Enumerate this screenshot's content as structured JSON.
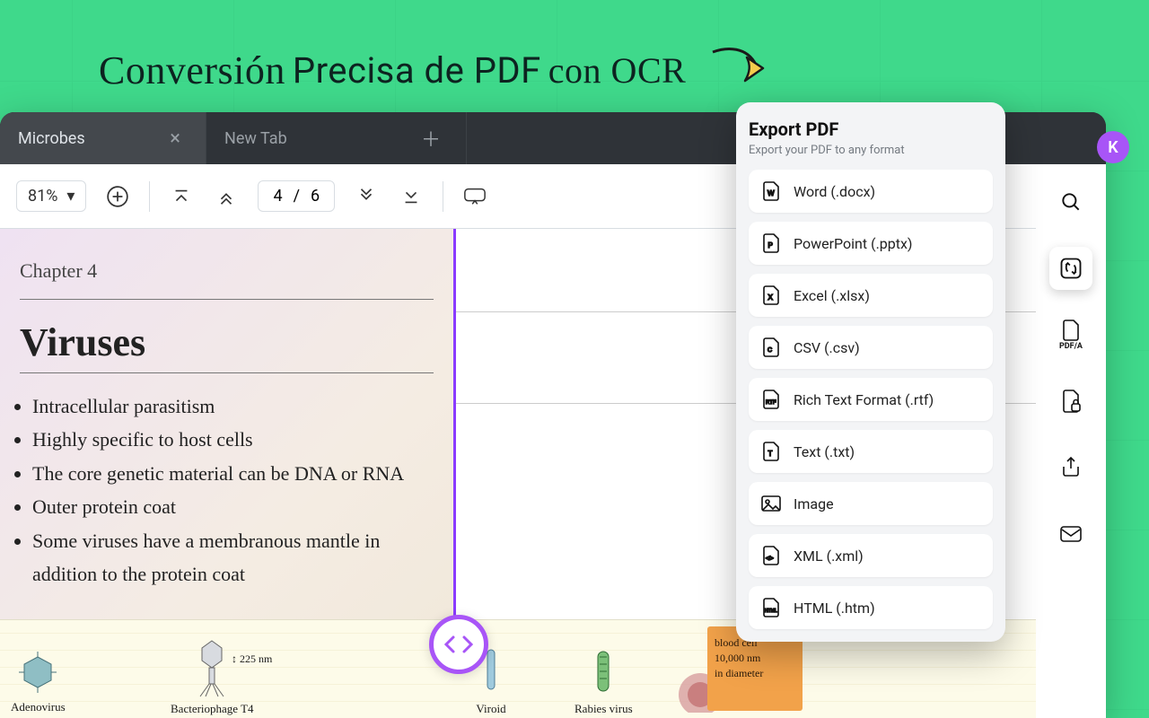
{
  "headline": {
    "p1": "Conversión",
    "p2": "Precisa de PDF",
    "p3": "con OCR"
  },
  "tabs": [
    {
      "label": "Microbes",
      "active": true
    },
    {
      "label": "New Tab",
      "active": false
    }
  ],
  "avatar": "K",
  "toolbar": {
    "zoom": "81%",
    "page_current": "4",
    "page_sep": "/",
    "page_total": "6"
  },
  "doc": {
    "chapter": "Chapter 4",
    "heading": "Viruses",
    "bullets": [
      "Intracellular parasitism",
      "Highly specific to host cells",
      "The core genetic material can be DNA or RNA",
      "Outer protein coat",
      "Some viruses have a membranous mantle in addition to the protein coat"
    ],
    "labels": {
      "adeno": "Adenovirus",
      "t4": "Bacteriophage T4",
      "t4_size": "225 nm",
      "viroid": "Viroid",
      "rabies": "Rabies virus",
      "post1": "blood cell",
      "post2": "10,000 nm",
      "post3": "in diameter"
    }
  },
  "export": {
    "title": "Export PDF",
    "subtitle": "Export your PDF to any format",
    "options": [
      "Word (.docx)",
      "PowerPoint (.pptx)",
      "Excel (.xlsx)",
      "CSV (.csv)",
      "Rich Text Format (.rtf)",
      "Text (.txt)",
      "Image",
      "XML (.xml)",
      "HTML (.htm)"
    ]
  }
}
